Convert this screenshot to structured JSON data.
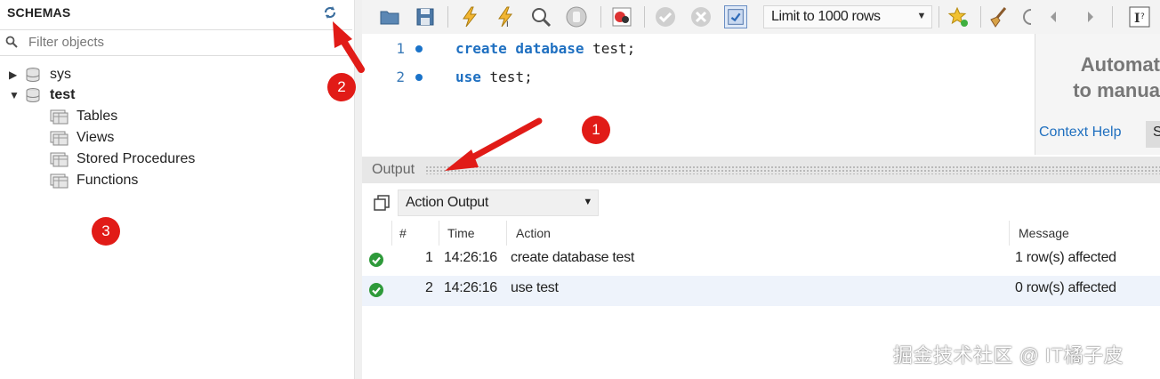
{
  "schemas": {
    "title": "SCHEMAS",
    "filter_placeholder": "Filter objects",
    "tree": [
      {
        "label": "sys",
        "expanded": false
      },
      {
        "label": "test",
        "expanded": true,
        "children": [
          "Tables",
          "Views",
          "Stored Procedures",
          "Functions"
        ]
      }
    ]
  },
  "toolbar": {
    "limit_label": "Limit to 1000 rows"
  },
  "editor": {
    "lines": [
      {
        "num": "1",
        "keywords": "create database",
        "rest": " test;"
      },
      {
        "num": "2",
        "keywords": "use",
        "rest": " test;"
      }
    ]
  },
  "help": {
    "text_line1": "Automat",
    "text_line2": "to manua",
    "tab_context": "Context Help",
    "tab_other": "S"
  },
  "output": {
    "label": "Output",
    "selector": "Action Output",
    "columns": [
      "#",
      "Time",
      "Action",
      "Message"
    ],
    "rows": [
      {
        "num": "1",
        "time": "14:26:16",
        "action": "create database test",
        "message": "1 row(s) affected"
      },
      {
        "num": "2",
        "time": "14:26:16",
        "action": "use test",
        "message": "0 row(s) affected"
      }
    ]
  },
  "annotations": {
    "badge_1": "1",
    "badge_2": "2",
    "badge_3": "3"
  },
  "watermark": "掘金技术社区 @ IT橘子皮",
  "colors": {
    "keyword": "#1f70c1",
    "success": "#2e9a3a",
    "annotation_red": "#e11b17",
    "row_highlight": "#eef3fb"
  }
}
